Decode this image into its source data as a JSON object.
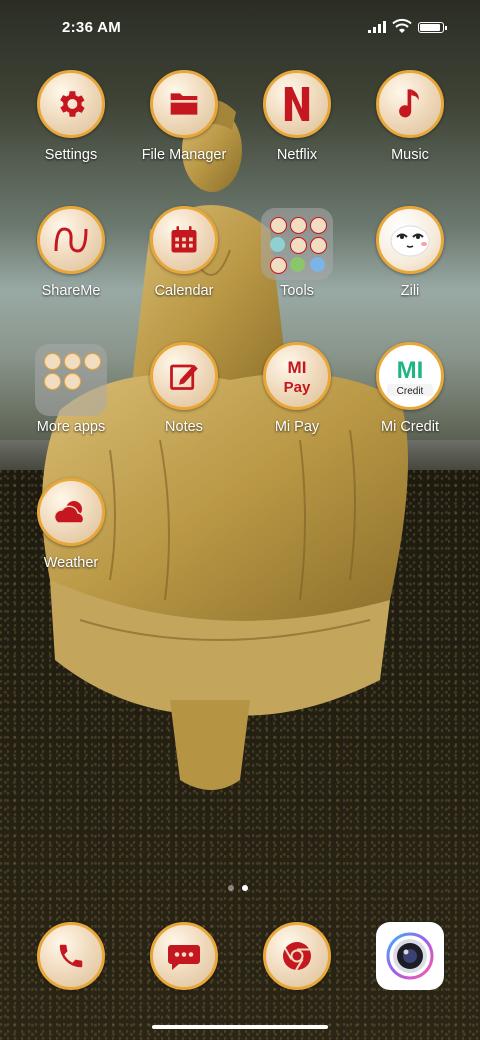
{
  "status_bar": {
    "time": "2:36 AM",
    "signal_icon": "cellular-signal-icon",
    "wifi_icon": "wifi-icon",
    "battery_icon": "battery-icon",
    "battery_level": 0.85
  },
  "apps": [
    {
      "label": "Settings",
      "icon": "gear-icon"
    },
    {
      "label": "File Manager",
      "icon": "folder-icon"
    },
    {
      "label": "Netflix",
      "icon": "netflix-n-icon"
    },
    {
      "label": "Music",
      "icon": "music-note-icon"
    },
    {
      "label": "ShareMe",
      "icon": "shareme-icon"
    },
    {
      "label": "Calendar",
      "icon": "calendar-icon"
    },
    {
      "label": "Tools",
      "icon": "folder-tools-icon"
    },
    {
      "label": "Zili",
      "icon": "zili-face-icon"
    },
    {
      "label": "More apps",
      "icon": "folder-more-apps-icon"
    },
    {
      "label": "Notes",
      "icon": "notes-edit-icon"
    },
    {
      "label": "Mi Pay",
      "icon": "mi-pay-icon",
      "logo_text": "MI Pay"
    },
    {
      "label": "Mi Credit",
      "icon": "mi-credit-icon",
      "logo_text": "MI"
    },
    {
      "label": "Weather",
      "icon": "weather-cloud-icon"
    }
  ],
  "page_indicator": {
    "pages": 2,
    "current": 2
  },
  "dock": [
    {
      "name": "phone",
      "icon": "phone-icon"
    },
    {
      "name": "messages",
      "icon": "message-bubble-icon"
    },
    {
      "name": "chrome",
      "icon": "chrome-icon"
    },
    {
      "name": "camera",
      "icon": "camera-icon"
    }
  ],
  "colors": {
    "icon_red": "#c4171f",
    "icon_ring": "#e8a73a",
    "icon_fill": "#f1dcc0"
  }
}
